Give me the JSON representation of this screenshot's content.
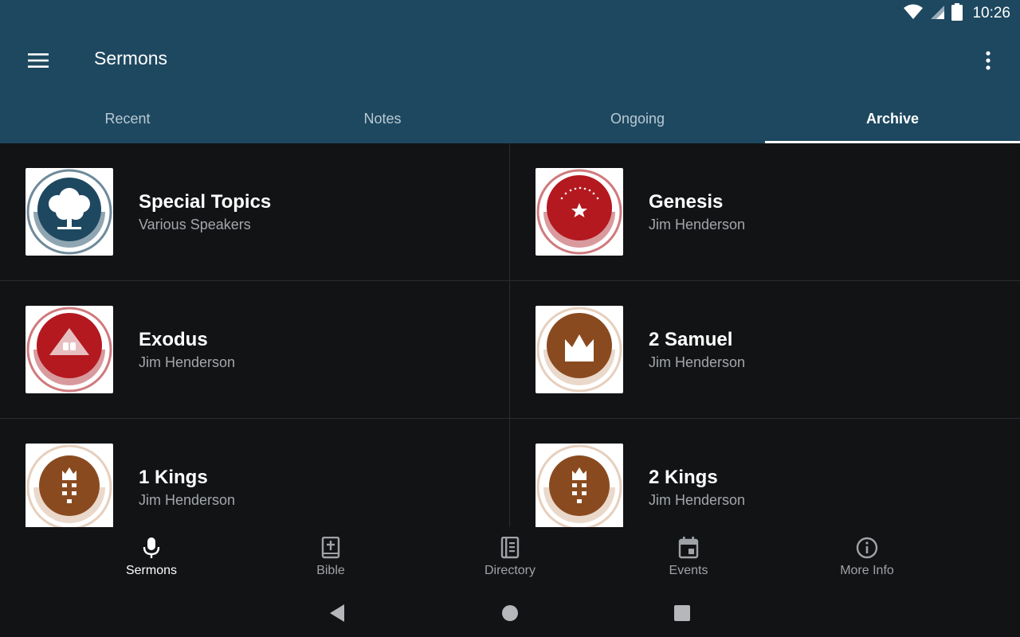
{
  "status_bar": {
    "time": "10:26",
    "icons": [
      "wifi-icon",
      "signal-icon",
      "battery-icon"
    ]
  },
  "app_bar": {
    "title": "Sermons",
    "menu_icon": "hamburger-menu-icon",
    "overflow_icon": "more-vertical-icon"
  },
  "tabs": [
    {
      "label": "Recent",
      "active": false
    },
    {
      "label": "Notes",
      "active": false
    },
    {
      "label": "Ongoing",
      "active": false
    },
    {
      "label": "Archive",
      "active": true
    }
  ],
  "series": [
    {
      "title": "Special Topics",
      "speaker": "Various Speakers",
      "icon": "tree-icon",
      "color": "#1e4860",
      "ring": "#6e8a9a"
    },
    {
      "title": "Genesis",
      "speaker": "Jim Henderson",
      "icon": "star-icon",
      "color": "#b3191f",
      "ring": "#cf7a7e"
    },
    {
      "title": "Exodus",
      "speaker": "Jim Henderson",
      "icon": "mountain-tablets-icon",
      "color": "#b3191f",
      "ring": "#cf7a7e"
    },
    {
      "title": "2 Samuel",
      "speaker": "Jim Henderson",
      "icon": "crown-icon",
      "color": "#8a4a1f",
      "ring": "#e6cfbd"
    },
    {
      "title": "1 Kings",
      "speaker": "Jim Henderson",
      "icon": "crown-lineage-icon",
      "color": "#8a4a1f",
      "ring": "#e6cfbd"
    },
    {
      "title": "2 Kings",
      "speaker": "Jim Henderson",
      "icon": "crown-lineage-icon",
      "color": "#8a4a1f",
      "ring": "#e6cfbd"
    }
  ],
  "bottom_nav": [
    {
      "label": "Sermons",
      "icon": "microphone-icon",
      "active": true
    },
    {
      "label": "Bible",
      "icon": "bible-icon",
      "active": false
    },
    {
      "label": "Directory",
      "icon": "directory-book-icon",
      "active": false
    },
    {
      "label": "Events",
      "icon": "calendar-icon",
      "active": false
    },
    {
      "label": "More Info",
      "icon": "info-icon",
      "active": false
    }
  ],
  "system_nav": [
    "back-icon",
    "home-icon",
    "recents-icon"
  ]
}
